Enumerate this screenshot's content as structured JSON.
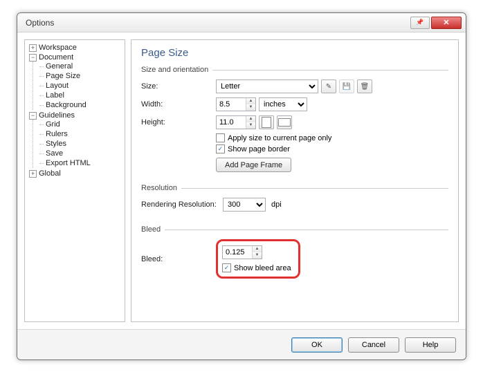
{
  "titlebar": {
    "title": "Options"
  },
  "tree": {
    "workspace": "Workspace",
    "document": "Document",
    "doc_items": {
      "general": "General",
      "page_size": "Page Size",
      "layout": "Layout",
      "label": "Label",
      "background": "Background"
    },
    "guidelines": "Guidelines",
    "guide_items": {
      "grid": "Grid",
      "rulers": "Rulers",
      "styles": "Styles",
      "save": "Save",
      "export_html": "Export HTML"
    },
    "global": "Global"
  },
  "page": {
    "title": "Page Size",
    "group_size": "Size and orientation",
    "size_label": "Size:",
    "size_value": "Letter",
    "width_label": "Width:",
    "width_value": "8.5",
    "unit_value": "inches",
    "height_label": "Height:",
    "height_value": "11.0",
    "apply_current": "Apply size to current page only",
    "show_border": "Show page border",
    "add_frame": "Add Page Frame",
    "group_res": "Resolution",
    "res_label": "Rendering Resolution:",
    "res_value": "300",
    "res_unit": "dpi",
    "group_bleed": "Bleed",
    "bleed_label": "Bleed:",
    "bleed_value": "0.125",
    "show_bleed": "Show bleed area"
  },
  "buttons": {
    "ok": "OK",
    "cancel": "Cancel",
    "help": "Help"
  }
}
